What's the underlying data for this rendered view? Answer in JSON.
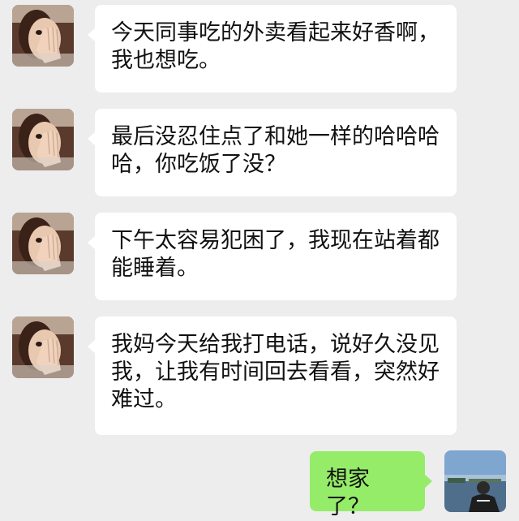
{
  "chat": {
    "messages": [
      {
        "sender": "contact",
        "text": "今天同事吃的外卖看起来好香啊，\n我也想吃。"
      },
      {
        "sender": "contact",
        "text": "最后没忍住点了和她一样的哈哈哈\n哈，你吃饭了没？"
      },
      {
        "sender": "contact",
        "text": "下午太容易犯困了，我现在站着都\n能睡着。"
      },
      {
        "sender": "contact",
        "text": "我妈今天给我打电话，说好久没见\n我，让我有时间回去看看，突然好\n难过。"
      },
      {
        "sender": "me",
        "text": "想家了？"
      }
    ]
  },
  "colors": {
    "background": "#ededed",
    "incoming_bubble": "#ffffff",
    "outgoing_bubble": "#95ec69",
    "text": "#111111"
  }
}
